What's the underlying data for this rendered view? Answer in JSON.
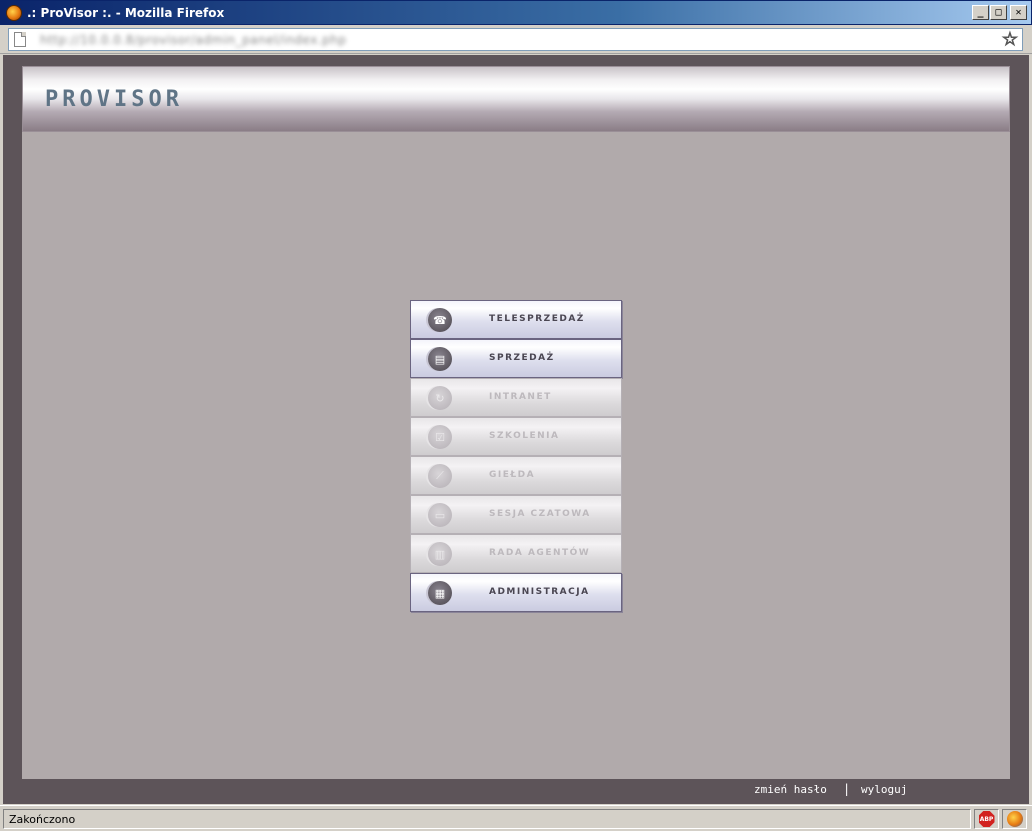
{
  "window": {
    "title": ".: ProVisor :. - Mozilla Firefox",
    "controls": {
      "minimize": "_",
      "maximize": "□",
      "close": "✕"
    }
  },
  "urlbar": {
    "url": "http://10.0.0.8/provisor/admin_panel/index.php"
  },
  "header": {
    "logo": "PROVISOR"
  },
  "menu": {
    "items": [
      {
        "label": "TELESPRZEDAŻ",
        "icon": "phone-icon",
        "glyph": "☎",
        "enabled": true
      },
      {
        "label": "SPRZEDAŻ",
        "icon": "cart-icon",
        "glyph": "▤",
        "enabled": true
      },
      {
        "label": "INTRANET",
        "icon": "network-icon",
        "glyph": "↻",
        "enabled": false
      },
      {
        "label": "SZKOLENIA",
        "icon": "training-icon",
        "glyph": "☑",
        "enabled": false
      },
      {
        "label": "GIEŁDA",
        "icon": "chart-icon",
        "glyph": "⟋",
        "enabled": false
      },
      {
        "label": "SESJA CZATOWA",
        "icon": "chat-icon",
        "glyph": "▭",
        "enabled": false
      },
      {
        "label": "RADA AGENTÓW",
        "icon": "board-icon",
        "glyph": "▥",
        "enabled": false
      },
      {
        "label": "ADMINISTRACJA",
        "icon": "admin-icon",
        "glyph": "▦",
        "enabled": true
      }
    ]
  },
  "footer": {
    "change_password": "zmień hasło",
    "separator": "|",
    "logout": "wyloguj"
  },
  "statusbar": {
    "text": "Zakończono",
    "abp_label": "ABP"
  }
}
